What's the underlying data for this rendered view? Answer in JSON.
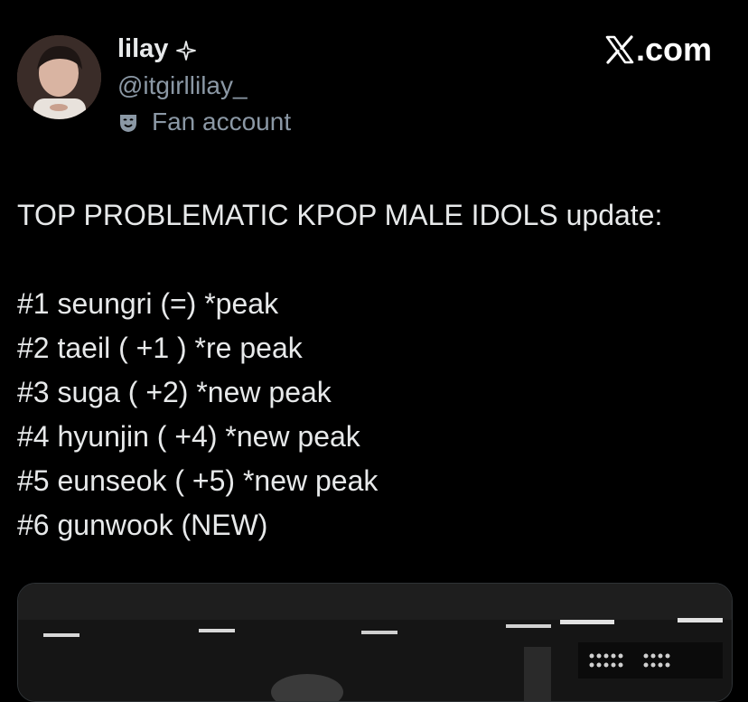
{
  "author": {
    "display_name": "lilay",
    "badge_icon": "sparkle-icon",
    "handle": "@itgirllilay_",
    "label": "Fan account",
    "label_icon": "theater-mask-icon"
  },
  "watermark": {
    "logo_icon": "x-logo-icon",
    "text": ".com"
  },
  "tweet": {
    "title_line": "TOP PROBLEMATIC KPOP MALE IDOLS update:",
    "items": [
      "#1 seungri (=) *peak",
      "#2 taeil ( +1 ) *re peak",
      "#3 suga ( +2) *new peak",
      "#4 hyunjin ( +4) *new peak",
      "#5 eunseok ( +5) *new peak",
      "#6 gunwook (NEW)"
    ]
  },
  "colors": {
    "background": "#000000",
    "text": "#e7e9ea",
    "secondary_text": "#8b98a5"
  }
}
